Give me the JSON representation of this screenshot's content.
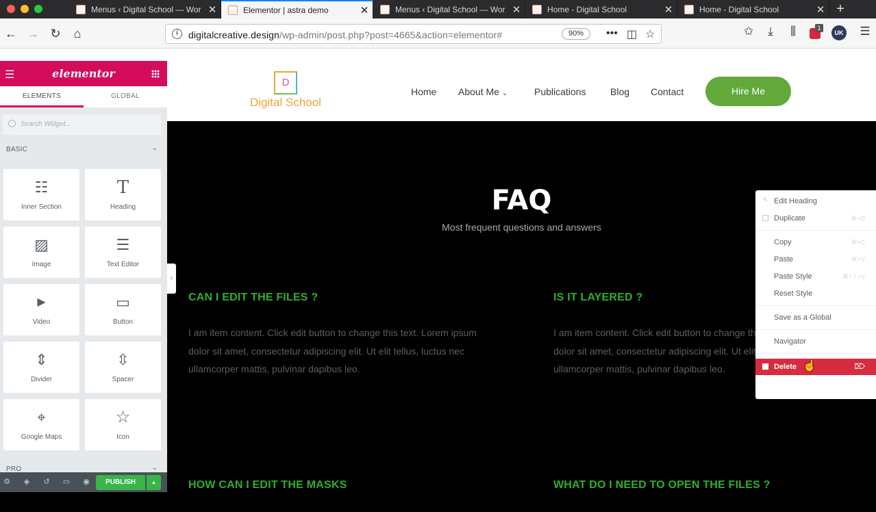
{
  "browser": {
    "tabs": [
      {
        "title": "Menus ‹ Digital School — Wor",
        "active": false
      },
      {
        "title": "Elementor | astra demo",
        "active": true
      },
      {
        "title": "Menus ‹ Digital School — Wor",
        "active": false
      },
      {
        "title": "Home - Digital School",
        "active": false
      },
      {
        "title": "Home - Digital School",
        "active": false
      }
    ],
    "close_glyph": "✕",
    "new_tab": "+",
    "url_domain": "digitalcreative.design",
    "url_path": "/wp-admin/post.php?post=4665&action=elementor#",
    "zoom": "90%",
    "ext_badge": "1",
    "ext_label": "UK"
  },
  "elementor": {
    "brand": "elementor",
    "tabs": [
      "ELEMENTS",
      "GLOBAL"
    ],
    "search_placeholder": "Search Widget...",
    "section_basic": "BASIC",
    "section_pro": "PRO",
    "widgets": [
      {
        "label": "Inner Section",
        "icon": "inner-section-icon",
        "glyph": "☷"
      },
      {
        "label": "Heading",
        "icon": "heading-icon",
        "glyph": "T"
      },
      {
        "label": "Image",
        "icon": "image-icon",
        "glyph": "▨"
      },
      {
        "label": "Text Editor",
        "icon": "text-editor-icon",
        "glyph": "☰"
      },
      {
        "label": "Video",
        "icon": "video-icon",
        "glyph": "▶"
      },
      {
        "label": "Button",
        "icon": "button-icon",
        "glyph": "▭"
      },
      {
        "label": "Divider",
        "icon": "divider-icon",
        "glyph": "⇕"
      },
      {
        "label": "Spacer",
        "icon": "spacer-icon",
        "glyph": "⇳"
      },
      {
        "label": "Google Maps",
        "icon": "google-maps-icon",
        "glyph": "⌖"
      },
      {
        "label": "Icon",
        "icon": "star-icon",
        "glyph": "☆"
      }
    ],
    "publish": "PUBLISH"
  },
  "site": {
    "logo_letter": "D",
    "logo_name": "Digital School",
    "menu": [
      "Home",
      "About Me",
      "Publications",
      "Blog",
      "Contact"
    ],
    "hire": "Hire Me",
    "faq_title": "FAQ",
    "faq_subtitle": "Most frequent questions and answers",
    "questions": [
      {
        "q": "CAN I EDIT THE FILES ?",
        "a": "I am item content. Click edit button to change this text. Lorem ipsum dolor sit amet, consectetur adipiscing elit. Ut elit tellus, luctus nec ullamcorper mattis, pulvinar dapibus leo."
      },
      {
        "q": "IS IT LAYERED ?",
        "a": "I am item content. Click edit button to change this text. Lorem ipsum dolor sit amet, consectetur adipiscing elit. Ut elit tellus, luctus nec ullamcorper mattis, pulvinar dapibus leo."
      },
      {
        "q": "HOW CAN I EDIT THE MASKS",
        "a": ""
      },
      {
        "q": "WHAT DO I NEED TO OPEN THE FILES ?",
        "a": ""
      }
    ],
    "accent_green": "#2fae2f",
    "button_green": "#62a83a"
  },
  "context_menu": {
    "items": [
      {
        "label": "Edit Heading",
        "shortcut": ""
      },
      {
        "label": "Duplicate",
        "shortcut": "⌘+D"
      },
      {
        "label": "Copy",
        "shortcut": "⌘+C"
      },
      {
        "label": "Paste",
        "shortcut": "⌘+V"
      },
      {
        "label": "Paste Style",
        "shortcut": "⌘+⇧+V"
      },
      {
        "label": "Reset Style",
        "shortcut": ""
      },
      {
        "label": "Save as a Global",
        "shortcut": ""
      },
      {
        "label": "Navigator",
        "shortcut": ""
      },
      {
        "label": "Delete",
        "shortcut": "⌦"
      }
    ],
    "danger_color": "#d72b3f"
  }
}
